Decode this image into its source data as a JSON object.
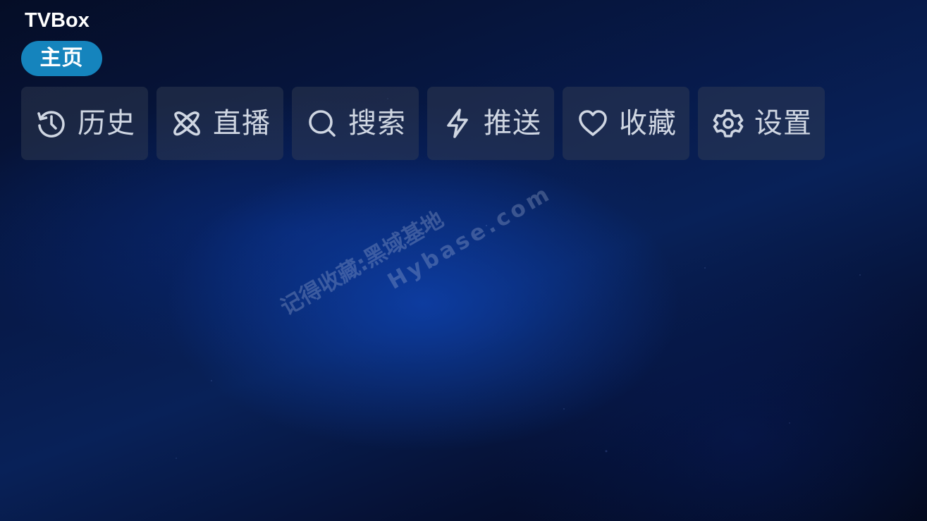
{
  "app": {
    "title": "TVBox"
  },
  "nav": {
    "home_tab": "主页"
  },
  "menu": {
    "items": [
      {
        "label": "历史",
        "icon": "history-icon"
      },
      {
        "label": "直播",
        "icon": "live-icon"
      },
      {
        "label": "搜索",
        "icon": "search-icon"
      },
      {
        "label": "推送",
        "icon": "push-icon"
      },
      {
        "label": "收藏",
        "icon": "favorite-icon"
      },
      {
        "label": "设置",
        "icon": "settings-icon"
      }
    ]
  },
  "watermark": {
    "line1": "记得收藏:黑域基地",
    "line2": "Hybase.com"
  },
  "colors": {
    "accent": "#1584bd",
    "button_bg": "#3a4256",
    "text": "#cfd6e2"
  }
}
